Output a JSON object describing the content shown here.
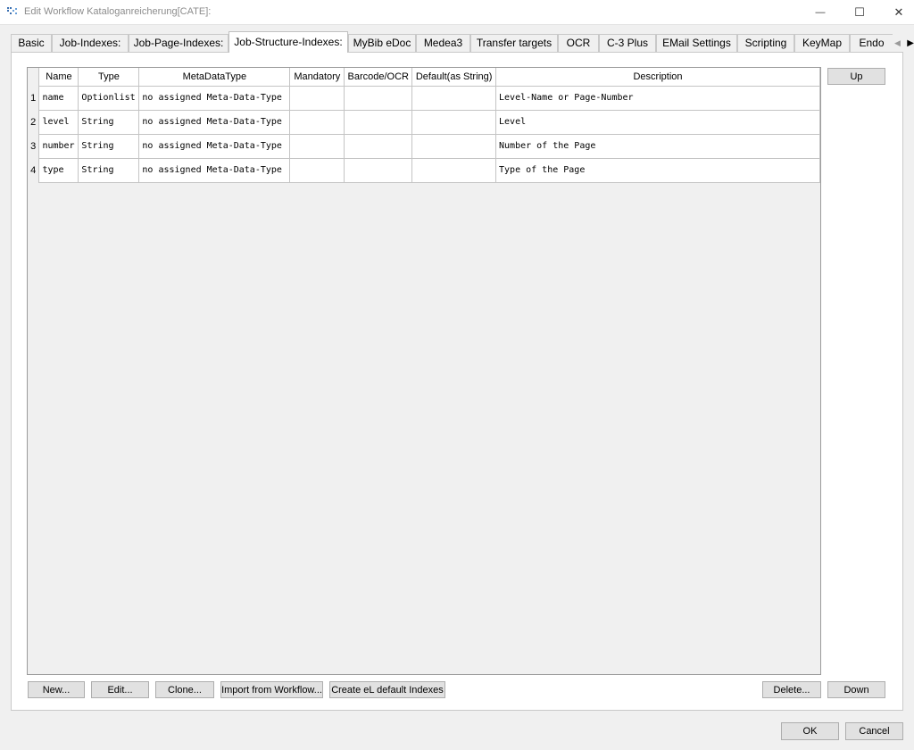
{
  "window": {
    "title": "Edit Workflow Kataloganreicherung[CATE]:",
    "minimize_glyph": "—",
    "maximize_glyph": "☐",
    "close_glyph": "✕"
  },
  "tabs": [
    {
      "label": "Basic"
    },
    {
      "label": "Job-Indexes:"
    },
    {
      "label": "Job-Page-Indexes:"
    },
    {
      "label": "Job-Structure-Indexes:"
    },
    {
      "label": "MyBib eDoc"
    },
    {
      "label": "Medea3"
    },
    {
      "label": "Transfer targets"
    },
    {
      "label": "OCR"
    },
    {
      "label": "C-3 Plus"
    },
    {
      "label": "EMail Settings"
    },
    {
      "label": "Scripting"
    },
    {
      "label": "KeyMap"
    },
    {
      "label": "Endo"
    }
  ],
  "tab_scroll": {
    "left": "◀",
    "right": "▶"
  },
  "table": {
    "columns": [
      "Name",
      "Type",
      "MetaDataType",
      "Mandatory",
      "Barcode/OCR",
      "Default(as String)",
      "Description"
    ],
    "rows": [
      {
        "num": "1",
        "name": "name",
        "type": "Optionlist",
        "metadatatype": "no assigned Meta-Data-Type",
        "mandatory": "",
        "barcode": "",
        "default": "",
        "description": "Level-Name or Page-Number"
      },
      {
        "num": "2",
        "name": "level",
        "type": "String",
        "metadatatype": "no assigned Meta-Data-Type",
        "mandatory": "",
        "barcode": "",
        "default": "",
        "description": "Level"
      },
      {
        "num": "3",
        "name": "number",
        "type": "String",
        "metadatatype": "no assigned Meta-Data-Type",
        "mandatory": "",
        "barcode": "",
        "default": "",
        "description": "Number of the Page"
      },
      {
        "num": "4",
        "name": "type",
        "type": "String",
        "metadatatype": "no assigned Meta-Data-Type",
        "mandatory": "",
        "barcode": "",
        "default": "",
        "description": "Type of the Page"
      }
    ]
  },
  "buttons": {
    "up": "Up",
    "down": "Down",
    "new": "New...",
    "edit": "Edit...",
    "clone": "Clone...",
    "import": "Import from Workflow...",
    "create_default": "Create eL default Indexes",
    "delete": "Delete...",
    "ok": "OK",
    "cancel": "Cancel"
  }
}
